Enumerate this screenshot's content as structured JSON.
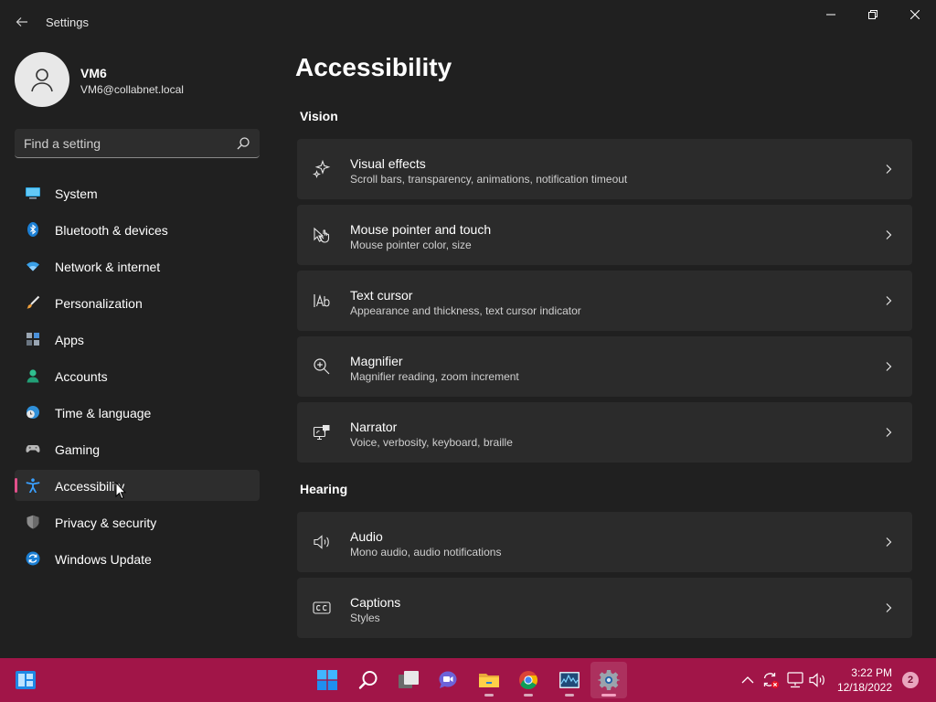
{
  "window": {
    "title": "Settings"
  },
  "profile": {
    "name": "VM6",
    "email": "VM6@collabnet.local"
  },
  "search": {
    "placeholder": "Find a setting",
    "icon": "search-icon"
  },
  "sidebar": {
    "items": [
      {
        "label": "System",
        "icon": "system-icon",
        "selected": false
      },
      {
        "label": "Bluetooth & devices",
        "icon": "bluetooth-icon",
        "selected": false
      },
      {
        "label": "Network & internet",
        "icon": "wifi-icon",
        "selected": false
      },
      {
        "label": "Personalization",
        "icon": "brush-icon",
        "selected": false
      },
      {
        "label": "Apps",
        "icon": "apps-icon",
        "selected": false
      },
      {
        "label": "Accounts",
        "icon": "accounts-icon",
        "selected": false
      },
      {
        "label": "Time & language",
        "icon": "globe-clock-icon",
        "selected": false
      },
      {
        "label": "Gaming",
        "icon": "gamepad-icon",
        "selected": false
      },
      {
        "label": "Accessibility",
        "icon": "accessibility-icon",
        "selected": true
      },
      {
        "label": "Privacy & security",
        "icon": "shield-icon",
        "selected": false
      },
      {
        "label": "Windows Update",
        "icon": "windows-update-icon",
        "selected": false
      }
    ]
  },
  "main": {
    "title": "Accessibility",
    "sections": [
      {
        "title": "Vision",
        "cards": [
          {
            "title": "Visual effects",
            "subtitle": "Scroll bars, transparency, animations, notification timeout",
            "icon": "sparkle-icon"
          },
          {
            "title": "Mouse pointer and touch",
            "subtitle": "Mouse pointer color, size",
            "icon": "mouse-pointer-touch-icon"
          },
          {
            "title": "Text cursor",
            "subtitle": "Appearance and thickness, text cursor indicator",
            "icon": "text-cursor-icon"
          },
          {
            "title": "Magnifier",
            "subtitle": "Magnifier reading, zoom increment",
            "icon": "magnifier-icon"
          },
          {
            "title": "Narrator",
            "subtitle": "Voice, verbosity, keyboard, braille",
            "icon": "narrator-icon"
          }
        ]
      },
      {
        "title": "Hearing",
        "cards": [
          {
            "title": "Audio",
            "subtitle": "Mono audio, audio notifications",
            "icon": "speaker-icon"
          },
          {
            "title": "Captions",
            "subtitle": "Styles",
            "icon": "captions-icon"
          }
        ]
      }
    ]
  },
  "taskbar": {
    "apps": [
      "start-icon",
      "search-icon",
      "task-view-icon",
      "teams-chat-icon",
      "file-explorer-icon",
      "chrome-icon",
      "resource-monitor-icon",
      "settings-icon"
    ],
    "active_app": "settings-icon",
    "clock": {
      "time": "3:22 PM",
      "date": "12/18/2022"
    },
    "notification_count": "2"
  },
  "colors": {
    "background": "#202020",
    "card": "#2b2b2b",
    "accent": "#e2508b",
    "taskbar": "#a11548"
  }
}
